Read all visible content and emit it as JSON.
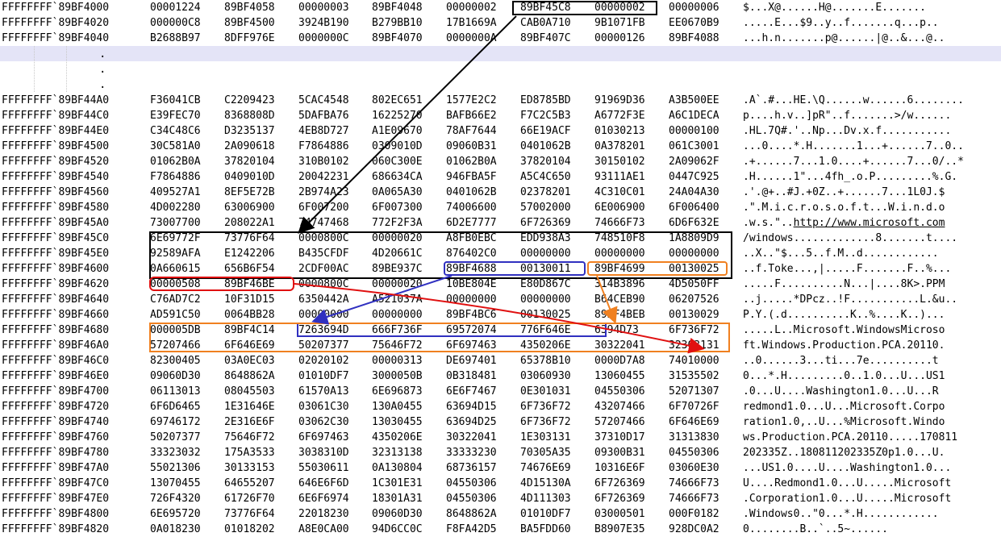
{
  "colors": {
    "black": "#000000",
    "red": "#e01010",
    "blue": "#3030c0",
    "orange": "#f08020",
    "gap_band": "#e4e4f7"
  },
  "top_rows": [
    {
      "address": "FFFFFFFF`89BF4000",
      "words": [
        "00001224",
        "89BF4058",
        "00000003",
        "89BF4048",
        "00000002",
        "89BF45C8",
        "00000002",
        "00000006"
      ],
      "ascii": "$...X@......H@.......E......."
    },
    {
      "address": "FFFFFFFF`89BF4020",
      "words": [
        "000000C8",
        "89BF4500",
        "3924B190",
        "B279BB10",
        "17B1669A",
        "CAB0A710",
        "9B1071FB",
        "EE0670B9"
      ],
      "ascii": ".....E...$9..y..f.......q...p.."
    },
    {
      "address": "FFFFFFFF`89BF4040",
      "words": [
        "B2688B97",
        "8DFF976E",
        "0000000C",
        "89BF4070",
        "0000000A",
        "89BF407C",
        "00000126",
        "89BF4088"
      ],
      "ascii": "...h.n.......p@......|@..&...@.."
    }
  ],
  "gap_dots": [
    ".",
    ".",
    "."
  ],
  "rows": [
    {
      "address": "FFFFFFFF`89BF44A0",
      "words": [
        "F36041CB",
        "C2209423",
        "5CAC4548",
        "802EC651",
        "1577E2C2",
        "ED8785BD",
        "91969D36",
        "A3B500EE"
      ],
      "ascii": ".A`.#...HE.\\Q......w......6........"
    },
    {
      "address": "FFFFFFFF`89BF44C0",
      "words": [
        "E39FEC70",
        "8368808D",
        "5DAFBA76",
        "16225270",
        "BAFB66E2",
        "F7C2C5B3",
        "A6772F3E",
        "A6C1DECA"
      ],
      "ascii": "p....h.v..]pR\"..f.......>/w......"
    },
    {
      "address": "FFFFFFFF`89BF44E0",
      "words": [
        "C34C48C6",
        "D3235137",
        "4EB8D727",
        "A1E09670",
        "78AF7644",
        "66E19ACF",
        "01030213",
        "00000100"
      ],
      "ascii": ".HL.7Q#.'..Np...Dv.x.f..........."
    },
    {
      "address": "FFFFFFFF`89BF4500",
      "words": [
        "30C581A0",
        "2A090618",
        "F7864886",
        "0309010D",
        "09060B31",
        "0401062B",
        "0A378201",
        "061C3001"
      ],
      "ascii": "...0....*.H.......1...+......7..0.."
    },
    {
      "address": "FFFFFFFF`89BF4520",
      "words": [
        "01062B0A",
        "37820104",
        "310B0102",
        "060C300E",
        "01062B0A",
        "37820104",
        "30150102",
        "2A09062F"
      ],
      "ascii": ".+......7...1.0....+......7...0/..*"
    },
    {
      "address": "FFFFFFFF`89BF4540",
      "words": [
        "F7864886",
        "0409010D",
        "20042231",
        "686634CA",
        "946FBA5F",
        "A5C4C650",
        "93111AE1",
        "0447C925"
      ],
      "ascii": ".H......1\"...4fh_.o.P.........%.G."
    },
    {
      "address": "FFFFFFFF`89BF4560",
      "words": [
        "409527A1",
        "8EF5E72B",
        "2B974A23",
        "0A065A30",
        "0401062B",
        "02378201",
        "4C310C01",
        "24A04A30"
      ],
      "ascii": ".'.@+..#J.+0Z..+......7...1L0J.$"
    },
    {
      "address": "FFFFFFFF`89BF4580",
      "words": [
        "4D002280",
        "63006900",
        "6F007200",
        "6F007300",
        "74006600",
        "57002000",
        "6E006900",
        "6F006400"
      ],
      "ascii": ".\".M.i.c.r.o.s.o.f.t...W.i.n.d.o"
    },
    {
      "address": "FFFFFFFF`89BF45A0",
      "words": [
        "73007700",
        "208022A1",
        "74747468",
        "772F2F3A",
        "6D2E7777",
        "6F726369",
        "74666F73",
        "6D6F632E"
      ],
      "ascii": ".w.s.\"..",
      "ascii_link": "http://www.microsoft.com"
    },
    {
      "address": "FFFFFFFF`89BF45C0",
      "words": [
        "6E69772F",
        "73776F64",
        "0000800C",
        "00000020",
        "A8FB0EBC",
        "EDD938A3",
        "748510F8",
        "1A8809D9"
      ],
      "ascii": "/windows.............8.......t...."
    },
    {
      "address": "FFFFFFFF`89BF45E0",
      "words": [
        "92589AFA",
        "E1242206",
        "B435CFDF",
        "4D20661C",
        "876402C0",
        "00000000",
        "00000000",
        "00000000"
      ],
      "ascii": "..X..\"$...5..f.M..d............"
    },
    {
      "address": "FFFFFFFF`89BF4600",
      "words": [
        "0A660615",
        "656B6F54",
        "2CDF00AC",
        "89BE937C",
        "89BF4688",
        "00130011",
        "89BF4699",
        "00130025"
      ],
      "ascii": "..f.Toke...,|.....F.......F..%..."
    },
    {
      "address": "FFFFFFFF`89BF4620",
      "words": [
        "00000508",
        "89BF46BE",
        "0000800C",
        "00000020",
        "10BE804E",
        "E80D867C",
        "314B3896",
        "4D5050FF"
      ],
      "ascii": ".....F..........N...|....8K>.PPM"
    },
    {
      "address": "FFFFFFFF`89BF4640",
      "words": [
        "C76AD7C2",
        "10F31D15",
        "6350442A",
        "A521037A",
        "00000000",
        "00000000",
        "B64CEB90",
        "06207526"
      ],
      "ascii": "..j.....*DPcz..!F...........L.&u.."
    },
    {
      "address": "FFFFFFFF`89BF4660",
      "words": [
        "AD591C50",
        "0064BB28",
        "00000000",
        "00000000",
        "89BF4BC6",
        "00130025",
        "89BF4BEB",
        "00130029"
      ],
      "ascii": "P.Y.(.d..........K..%....K..)..."
    },
    {
      "address": "FFFFFFFF`89BF4680",
      "words": [
        "000005DB",
        "89BF4C14",
        "7263694D",
        "666F736F",
        "69572074",
        "776F646E",
        "6394D73",
        "6F736F72"
      ],
      "ascii": ".....L..Microsoft.WindowsMicroso"
    },
    {
      "address": "FFFFFFFF`89BF46A0",
      "words": [
        "57207466",
        "6F646E69",
        "50207377",
        "75646F72",
        "6F697463",
        "4350206E",
        "30322041",
        "32303131"
      ],
      "ascii": "ft.Windows.Production.PCA.20110."
    },
    {
      "address": "FFFFFFFF`89BF46C0",
      "words": [
        "82300405",
        "03A0EC03",
        "02020102",
        "00000313",
        "DE697401",
        "65378B10",
        "0000D7A8",
        "74010000"
      ],
      "ascii": "..0......3...ti...7e..........t"
    },
    {
      "address": "FFFFFFFF`89BF46E0",
      "words": [
        "09060D30",
        "8648862A",
        "01010DF7",
        "3000050B",
        "0B318481",
        "03060930",
        "13060455",
        "31535502"
      ],
      "ascii": "0...*.H.........0..1.0...U...US1"
    },
    {
      "address": "FFFFFFFF`89BF4700",
      "words": [
        "06113013",
        "08045503",
        "61570A13",
        "6E696873",
        "6E6F7467",
        "0E301031",
        "04550306",
        "52071307"
      ],
      "ascii": ".0...U....Washington1.0...U...R"
    },
    {
      "address": "FFFFFFFF`89BF4720",
      "words": [
        "6F6D6465",
        "1E31646E",
        "03061C30",
        "130A0455",
        "63694D15",
        "6F736F72",
        "43207466",
        "6F70726F"
      ],
      "ascii": "redmond1.0...U...Microsoft.Corpo"
    },
    {
      "address": "FFFFFFFF`89BF4740",
      "words": [
        "69746172",
        "2E316E6F",
        "03062C30",
        "13030455",
        "63694D25",
        "6F736F72",
        "57207466",
        "6F646E69"
      ],
      "ascii": "ration1.0,..U...%Microsoft.Windo"
    },
    {
      "address": "FFFFFFFF`89BF4760",
      "words": [
        "50207377",
        "75646F72",
        "6F697463",
        "4350206E",
        "30322041",
        "1E303131",
        "37310D17",
        "31313830"
      ],
      "ascii": "ws.Production.PCA.20110.....170811"
    },
    {
      "address": "FFFFFFFF`89BF4780",
      "words": [
        "33323032",
        "175A3533",
        "3038310D",
        "32313138",
        "33333230",
        "70305A35",
        "09300B31",
        "04550306"
      ],
      "ascii": "202335Z..180811202335Z0p1.0...U."
    },
    {
      "address": "FFFFFFFF`89BF47A0",
      "words": [
        "55021306",
        "30133153",
        "55030611",
        "0A130804",
        "68736157",
        "74676E69",
        "10316E6F",
        "03060E30"
      ],
      "ascii": "...US1.0....U....Washington1.0..."
    },
    {
      "address": "FFFFFFFF`89BF47C0",
      "words": [
        "13070455",
        "64655207",
        "646E6F6D",
        "1C301E31",
        "04550306",
        "4D15130A",
        "6F726369",
        "74666F73"
      ],
      "ascii": "U....Redmond1.0...U.....Microsoft"
    },
    {
      "address": "FFFFFFFF`89BF47E0",
      "words": [
        "726F4320",
        "61726F70",
        "6E6F6974",
        "18301A31",
        "04550306",
        "4D111303",
        "6F726369",
        "74666F73"
      ],
      "ascii": ".Corporation1.0...U.....Microsoft"
    },
    {
      "address": "FFFFFFFF`89BF4800",
      "words": [
        "6E695720",
        "73776F64",
        "22018230",
        "09060D30",
        "8648862A",
        "01010DF7",
        "03000501",
        "000F0182"
      ],
      "ascii": ".Windows0..\"0...*.H............"
    },
    {
      "address": "FFFFFFFF`89BF4820",
      "words": [
        "0A018230",
        "01018202",
        "A8E0CA00",
        "94D6CC0C",
        "F8FA42D5",
        "BA5FDD60",
        "B8907E35",
        "928DC0A2"
      ],
      "ascii": "0........B..`..5~......"
    }
  ]
}
